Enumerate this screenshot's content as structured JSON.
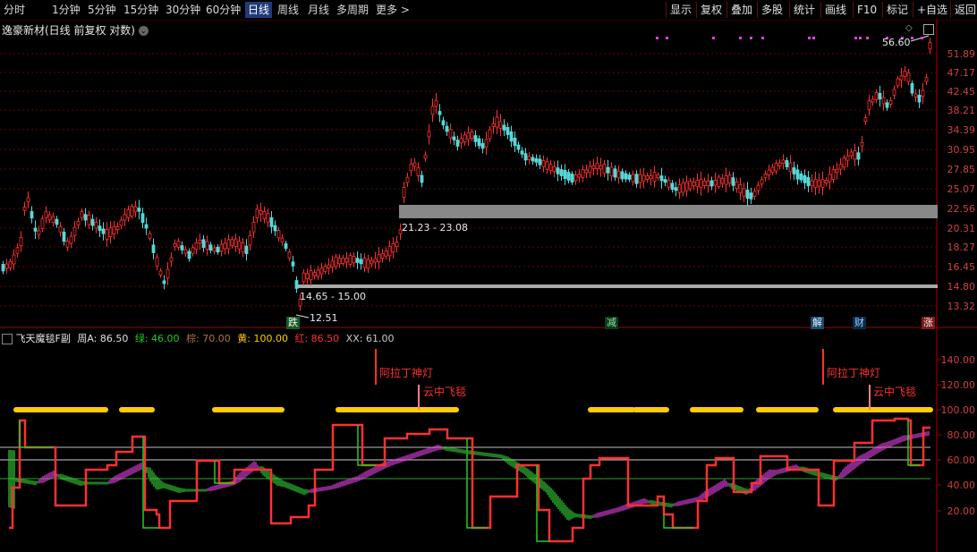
{
  "toolbar": {
    "periods": [
      "分时",
      "1分钟",
      "5分钟",
      "15分钟",
      "30分钟",
      "60分钟",
      "日线",
      "周线",
      "月线",
      "多周期",
      "更多"
    ],
    "active": "日线",
    "right_buttons": [
      "显示",
      "复权",
      "叠加",
      "多股",
      "统计",
      "画线",
      "F10",
      "标记",
      "+自选",
      "返回"
    ]
  },
  "main_panel": {
    "title": "逸豪新材(日线 前复权 对数)",
    "y_ticks": [
      "51.89",
      "47.17",
      "42.45",
      "38.21",
      "34.39",
      "30.95",
      "27.85",
      "25.07",
      "22.56",
      "20.31",
      "18.27",
      "16.45",
      "14.80",
      "13.32"
    ],
    "high_label": "56.60",
    "low_label": "12.51",
    "gap_upper": "21.23 - 23.08",
    "gap_lower": "14.65 - 15.00",
    "event_tags": [
      {
        "text": "跌",
        "color": "#22aa44"
      },
      {
        "text": "减",
        "color": "#22aa44"
      },
      {
        "text": "解",
        "color": "#2a88cc"
      },
      {
        "text": "财",
        "color": "#2a88cc"
      },
      {
        "text": "涨",
        "color": "#d03030"
      }
    ]
  },
  "indicator_panel": {
    "name": "飞天魔毯F副",
    "legend": [
      {
        "label": "周A: 86.50",
        "color": "#e0e0e0"
      },
      {
        "label": "绿: 46.00",
        "color": "#22cc22"
      },
      {
        "label": "棕: 70.00",
        "color": "#b07040"
      },
      {
        "label": "黄: 100.00",
        "color": "#ffcc00"
      },
      {
        "label": "红: 86.50",
        "color": "#ff3030"
      },
      {
        "label": "XX: 61.00",
        "color": "#c8c8c8"
      }
    ],
    "y_ticks": [
      "140.00",
      "120.00",
      "100.00",
      "80.00",
      "60.00",
      "40.00",
      "20.00"
    ],
    "annotations": [
      {
        "text": "阿拉丁神灯"
      },
      {
        "text": "云中飞毯"
      },
      {
        "text": "阿拉丁神灯"
      },
      {
        "text": "云中飞毯"
      }
    ]
  },
  "colors": {
    "up": "#ff3030",
    "down": "#54d8d8",
    "grid": "#6a0000",
    "accent": "#ff3030",
    "magenta": "#e040e0",
    "green": "#22cc22",
    "yellow": "#ffcc00"
  }
}
